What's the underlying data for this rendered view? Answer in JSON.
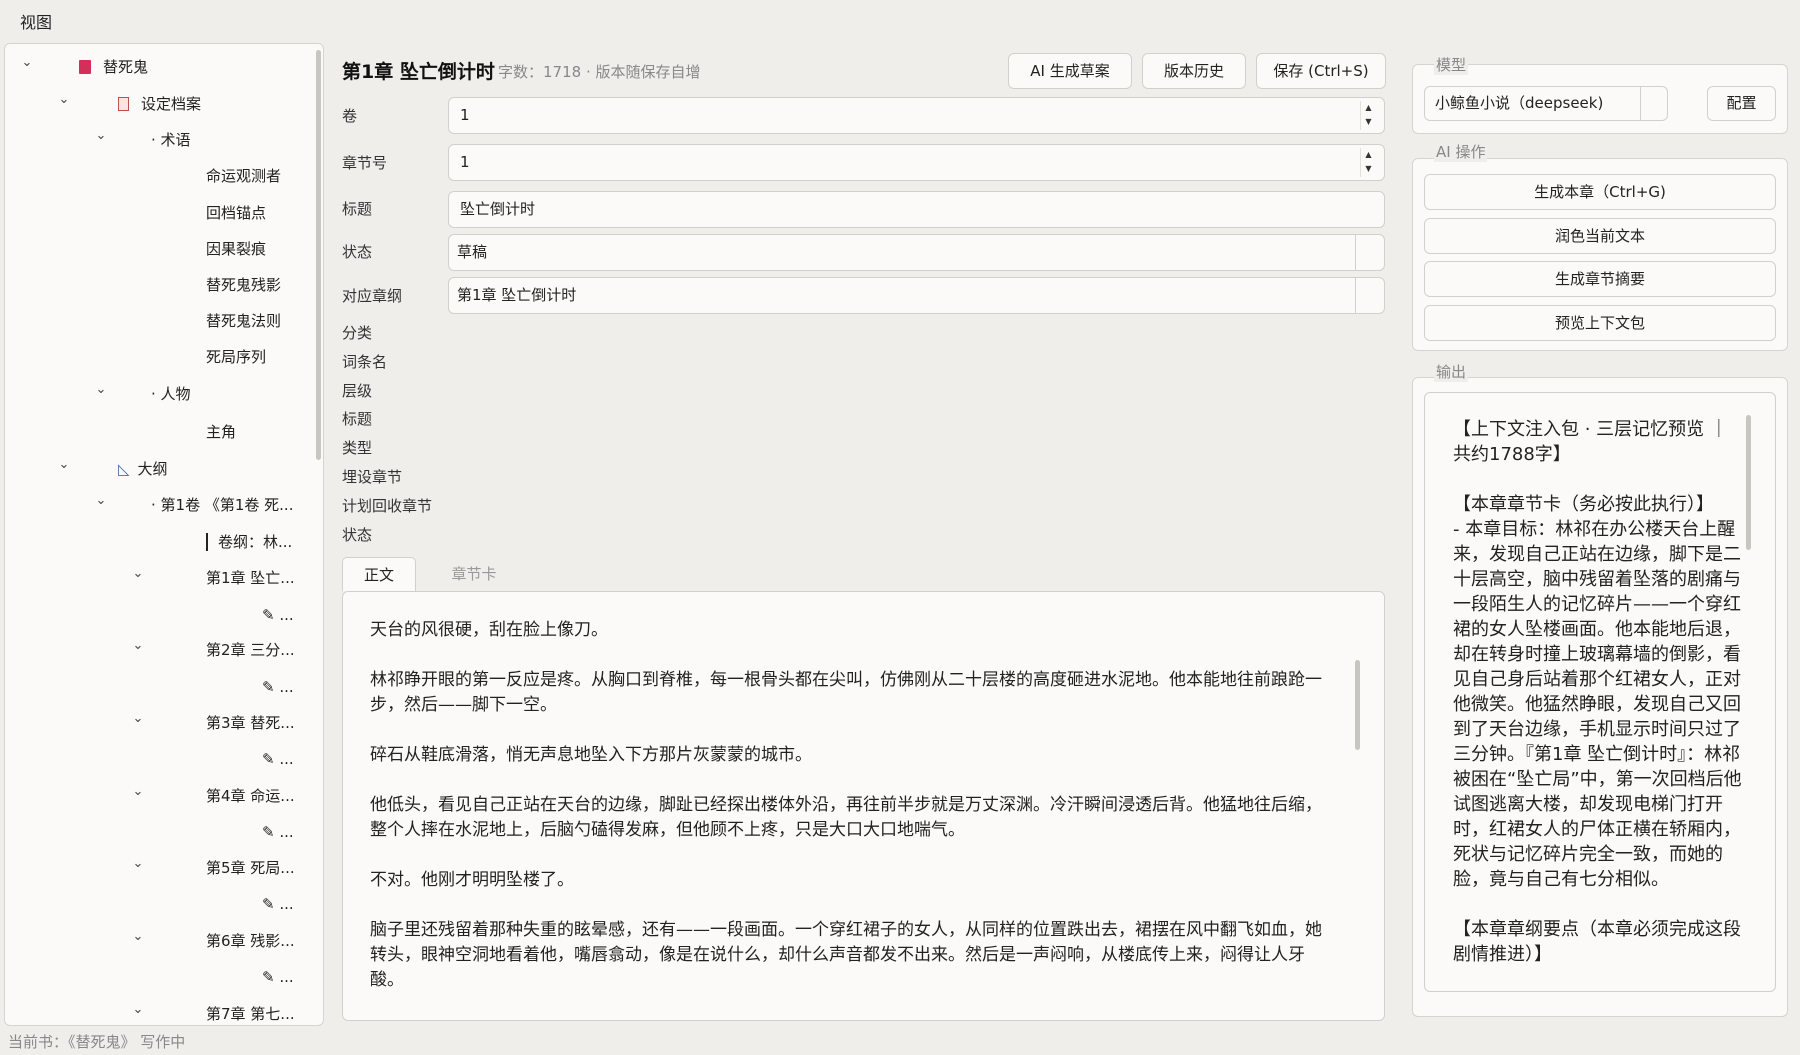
{
  "menubar": {
    "view": "视图"
  },
  "tree": {
    "items": [
      {
        "label": "替死鬼",
        "chev": "⌄",
        "icon": "book-icon"
      },
      {
        "label": "设定档案",
        "chev": "⌄",
        "icon": "file-icon"
      },
      {
        "label": "· 术语",
        "chev": "⌄"
      },
      {
        "label": "命运观测者"
      },
      {
        "label": "回档锚点"
      },
      {
        "label": "因果裂痕"
      },
      {
        "label": "替死鬼残影"
      },
      {
        "label": "替死鬼法则"
      },
      {
        "label": "死局序列"
      },
      {
        "label": "· 人物",
        "chev": "⌄"
      },
      {
        "label": "主角"
      },
      {
        "label": "大纲",
        "chev": "⌄",
        "icon": "ruler-icon"
      },
      {
        "label": "· 第1卷 《第1卷 死...",
        "chev": "⌄"
      },
      {
        "label": "卷纲：林...",
        "selected": true
      },
      {
        "label": "第1章 坠亡...",
        "chev": "⌄"
      },
      {
        "label": "...",
        "icon": "pencil-icon"
      },
      {
        "label": "第2章 三分...",
        "chev": "⌄"
      },
      {
        "label": "...",
        "icon": "pencil-icon"
      },
      {
        "label": "第3章 替死...",
        "chev": "⌄"
      },
      {
        "label": "...",
        "icon": "pencil-icon"
      },
      {
        "label": "第4章 命运...",
        "chev": "⌄"
      },
      {
        "label": "...",
        "icon": "pencil-icon"
      },
      {
        "label": "第5章 死局...",
        "chev": "⌄"
      },
      {
        "label": "...",
        "icon": "pencil-icon"
      },
      {
        "label": "第6章 残影...",
        "chev": "⌄"
      },
      {
        "label": "...",
        "icon": "pencil-icon"
      },
      {
        "label": "第7章 第七...",
        "chev": "⌄"
      }
    ]
  },
  "header": {
    "title": "第1章 坠亡倒计时",
    "meta": "字数：1718 · 版本随保存自增",
    "btn_ai_draft": "AI 生成草案",
    "btn_history": "版本历史",
    "btn_save": "保存 (Ctrl+S)"
  },
  "form": {
    "volume_label": "卷",
    "volume_value": "1",
    "chapter_no_label": "章节号",
    "chapter_no_value": "1",
    "title_label": "标题",
    "title_value": "坠亡倒计时",
    "status_label": "状态",
    "status_value": "草稿",
    "outline_label": "对应章纲",
    "outline_value": "第1章 坠亡倒计时"
  },
  "meta_fields": [
    "分类",
    "词条名",
    "层级",
    "标题",
    "类型",
    "埋设章节",
    "计划回收章节",
    "状态"
  ],
  "tabs": {
    "body": "正文",
    "card": "章节卡"
  },
  "editor": {
    "paragraphs": [
      "天台的风很硬，刮在脸上像刀。",
      "林祁睁开眼的第一反应是疼。从胸口到脊椎，每一根骨头都在尖叫，仿佛刚从二十层楼的高度砸进水泥地。他本能地往前踉跄一步，然后——脚下一空。",
      "碎石从鞋底滑落，悄无声息地坠入下方那片灰蒙蒙的城市。",
      "他低头，看见自己正站在天台的边缘，脚趾已经探出楼体外沿，再往前半步就是万丈深渊。冷汗瞬间浸透后背。他猛地往后缩，整个人摔在水泥地上，后脑勺磕得发麻，但他顾不上疼，只是大口大口地喘气。",
      "不对。他刚才明明坠楼了。",
      "脑子里还残留着那种失重的眩晕感，还有——一段画面。一个穿红裙子的女人，从同样的位置跌出去，裙摆在风中翻飞如血，她转头，眼神空洞地看着他，嘴唇翕动，像是在说什么，却什么声音都发不出来。然后是一声闷响，从楼底传上来，闷得让人牙酸。"
    ]
  },
  "right": {
    "model_title": "模型",
    "model_value": "小鲸鱼小说（deepseek)",
    "config_button": "配置",
    "ai_ops_title": "AI 操作",
    "ai_buttons": [
      "生成本章（Ctrl+G)",
      "润色当前文本",
      "生成章节摘要",
      "预览上下文包"
    ],
    "output_title": "输出",
    "output_text": "【上下文注入包 · 三层记忆预览 ｜ 共约1788字】\n\n【本章章节卡（务必按此执行）】\n- 本章目标：林祁在办公楼天台上醒来，发现自己正站在边缘，脚下是二十层高空，脑中残留着坠落的剧痛与一段陌生人的记忆碎片——一个穿红裙的女人坠楼画面。他本能地后退，却在转身时撞上玻璃幕墙的倒影，看见自己身后站着那个红裙女人，正对他微笑。他猛然睁眼，发现自己又回到了天台边缘，手机显示时间只过了三分钟。『第1章 坠亡倒计时』：林祁被困在“坠亡局”中，第一次回档后他试图逃离大楼，却发现电梯门打开时，红裙女人的尸体正横在轿厢内，死状与记忆碎片完全一致，而她的脸，竟与自己有七分相似。\n\n【本章章纲要点（本章必须完成这段剧情推进）】"
  },
  "status_bar": "当前书：《替死鬼》 写作中"
}
